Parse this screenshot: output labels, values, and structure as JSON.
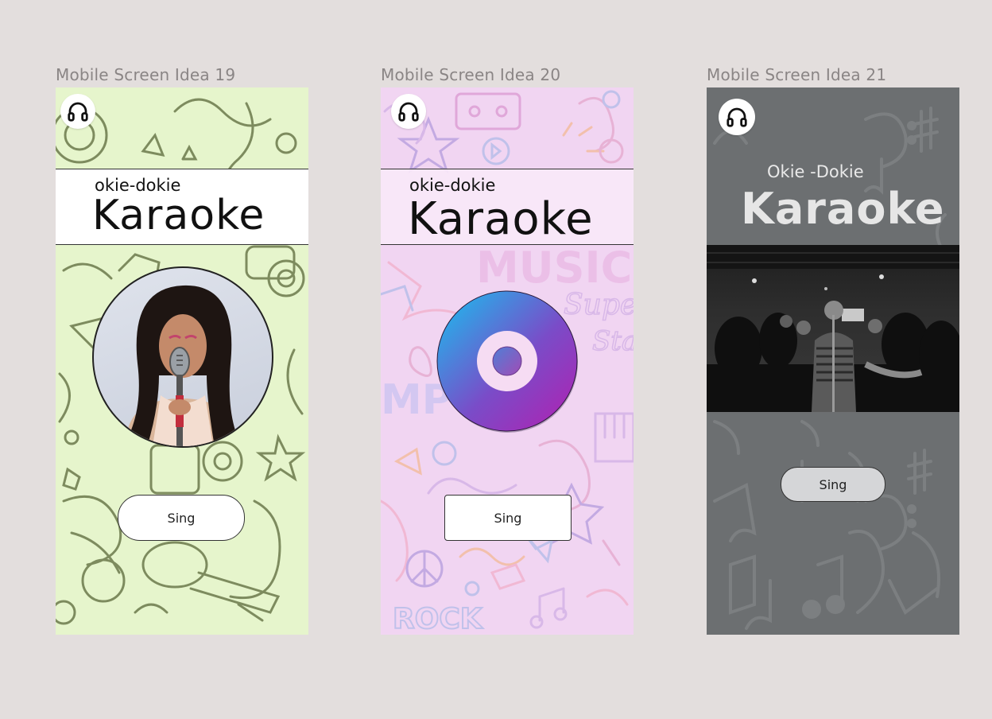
{
  "frames": [
    {
      "label": "Mobile Screen Idea 19",
      "subtitle": "okie-dokie",
      "title": "Karaoke",
      "button": "Sing",
      "icon": "headphones-icon",
      "bg_color": "#e6f5cc"
    },
    {
      "label": "Mobile Screen Idea 20",
      "subtitle": "okie-dokie",
      "title": "Karaoke",
      "button": "Sing",
      "icon": "headphones-icon",
      "bg_color": "#f1d5f2"
    },
    {
      "label": "Mobile Screen Idea 21",
      "subtitle": "Okie -Dokie",
      "title": "Karaoke",
      "button": "Sing",
      "icon": "headphones-icon",
      "bg_color": "#6c6f71"
    }
  ]
}
